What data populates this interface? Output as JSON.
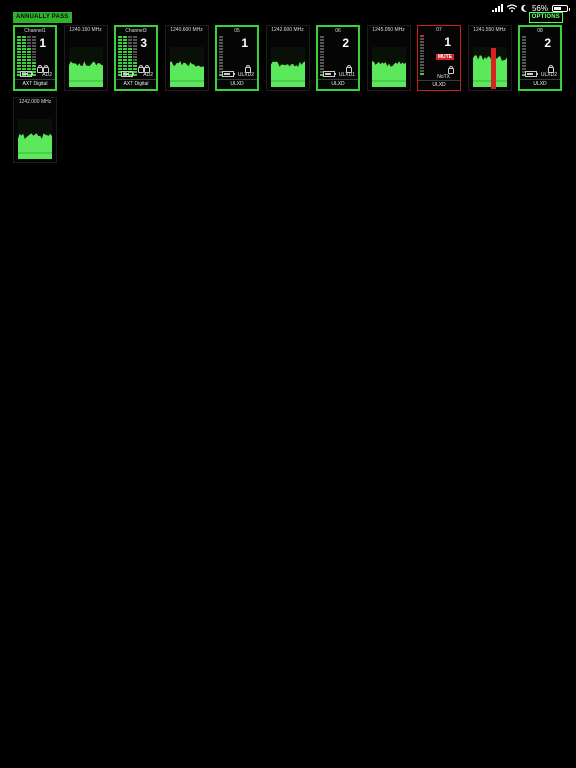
{
  "status": {
    "battery_text": "56%",
    "battery_level": 0.56
  },
  "top": {
    "pass_label": "ANNUALLY PASS",
    "options_label": "OPTIONS"
  },
  "cards": [
    {
      "kind": "channel",
      "header": "Channel1",
      "number": "1",
      "code": "AD2",
      "footer": "AXT Digital"
    },
    {
      "kind": "rf",
      "header": "1240.150 MHz"
    },
    {
      "kind": "channel",
      "header": "Channel3",
      "number": "3",
      "code": "AD2",
      "footer": "AXT Digital"
    },
    {
      "kind": "rf",
      "header": "1240.600 MHz"
    },
    {
      "kind": "channel",
      "header": "05",
      "number": "1",
      "code": "ULXD2",
      "footer": "ULXD"
    },
    {
      "kind": "rf",
      "header": "1242.600 MHz"
    },
    {
      "kind": "channel",
      "header": "06",
      "number": "2",
      "code": "ULXD1",
      "footer": "ULXD"
    },
    {
      "kind": "rf",
      "header": "1245.050 MHz"
    },
    {
      "kind": "alarm",
      "header": "07",
      "number": "1",
      "mute_label": "MUTE",
      "code": "NoTX",
      "footer": "ULXD"
    },
    {
      "kind": "rf",
      "header": "1241.550 MHz"
    },
    {
      "kind": "channel",
      "header": "08",
      "number": "2",
      "code": "ULXD2",
      "footer": "ULXD"
    },
    {
      "kind": "rf",
      "header": "1242.000 MHz"
    }
  ],
  "colors": {
    "accent": "#3ad13a",
    "alarm": "#d42424",
    "background": "#000000"
  }
}
